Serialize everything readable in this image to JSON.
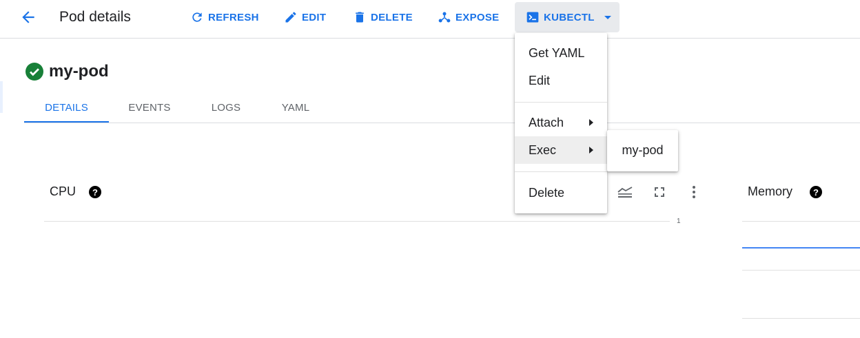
{
  "header": {
    "title": "Pod details",
    "back_icon": "arrow-back-icon",
    "actions": [
      {
        "label": "REFRESH",
        "icon": "refresh-icon"
      },
      {
        "label": "EDIT",
        "icon": "edit-icon"
      },
      {
        "label": "DELETE",
        "icon": "trash-icon"
      },
      {
        "label": "EXPOSE",
        "icon": "expose-icon"
      }
    ],
    "kubectl": {
      "label": "KUBECTL",
      "icon": "terminal-icon"
    }
  },
  "pod": {
    "name": "my-pod",
    "status_icon": "check-circle-icon",
    "status_color": "#188038"
  },
  "tabs": [
    {
      "label": "DETAILS",
      "active": true
    },
    {
      "label": "EVENTS"
    },
    {
      "label": "LOGS"
    },
    {
      "label": "YAML"
    }
  ],
  "charts": {
    "cpu": {
      "label": "CPU",
      "help": "?",
      "tick": "1"
    },
    "memory": {
      "label": "Memory",
      "help": "?"
    }
  },
  "kubectl_menu": {
    "items": [
      "Get YAML",
      "Edit",
      "Attach",
      "Exec",
      "Delete"
    ],
    "highlighted": "Exec",
    "exec_submenu": [
      "my-pod"
    ]
  },
  "colors": {
    "accent": "#1a73e8",
    "text": "#202124",
    "secondary": "#5f6368"
  }
}
